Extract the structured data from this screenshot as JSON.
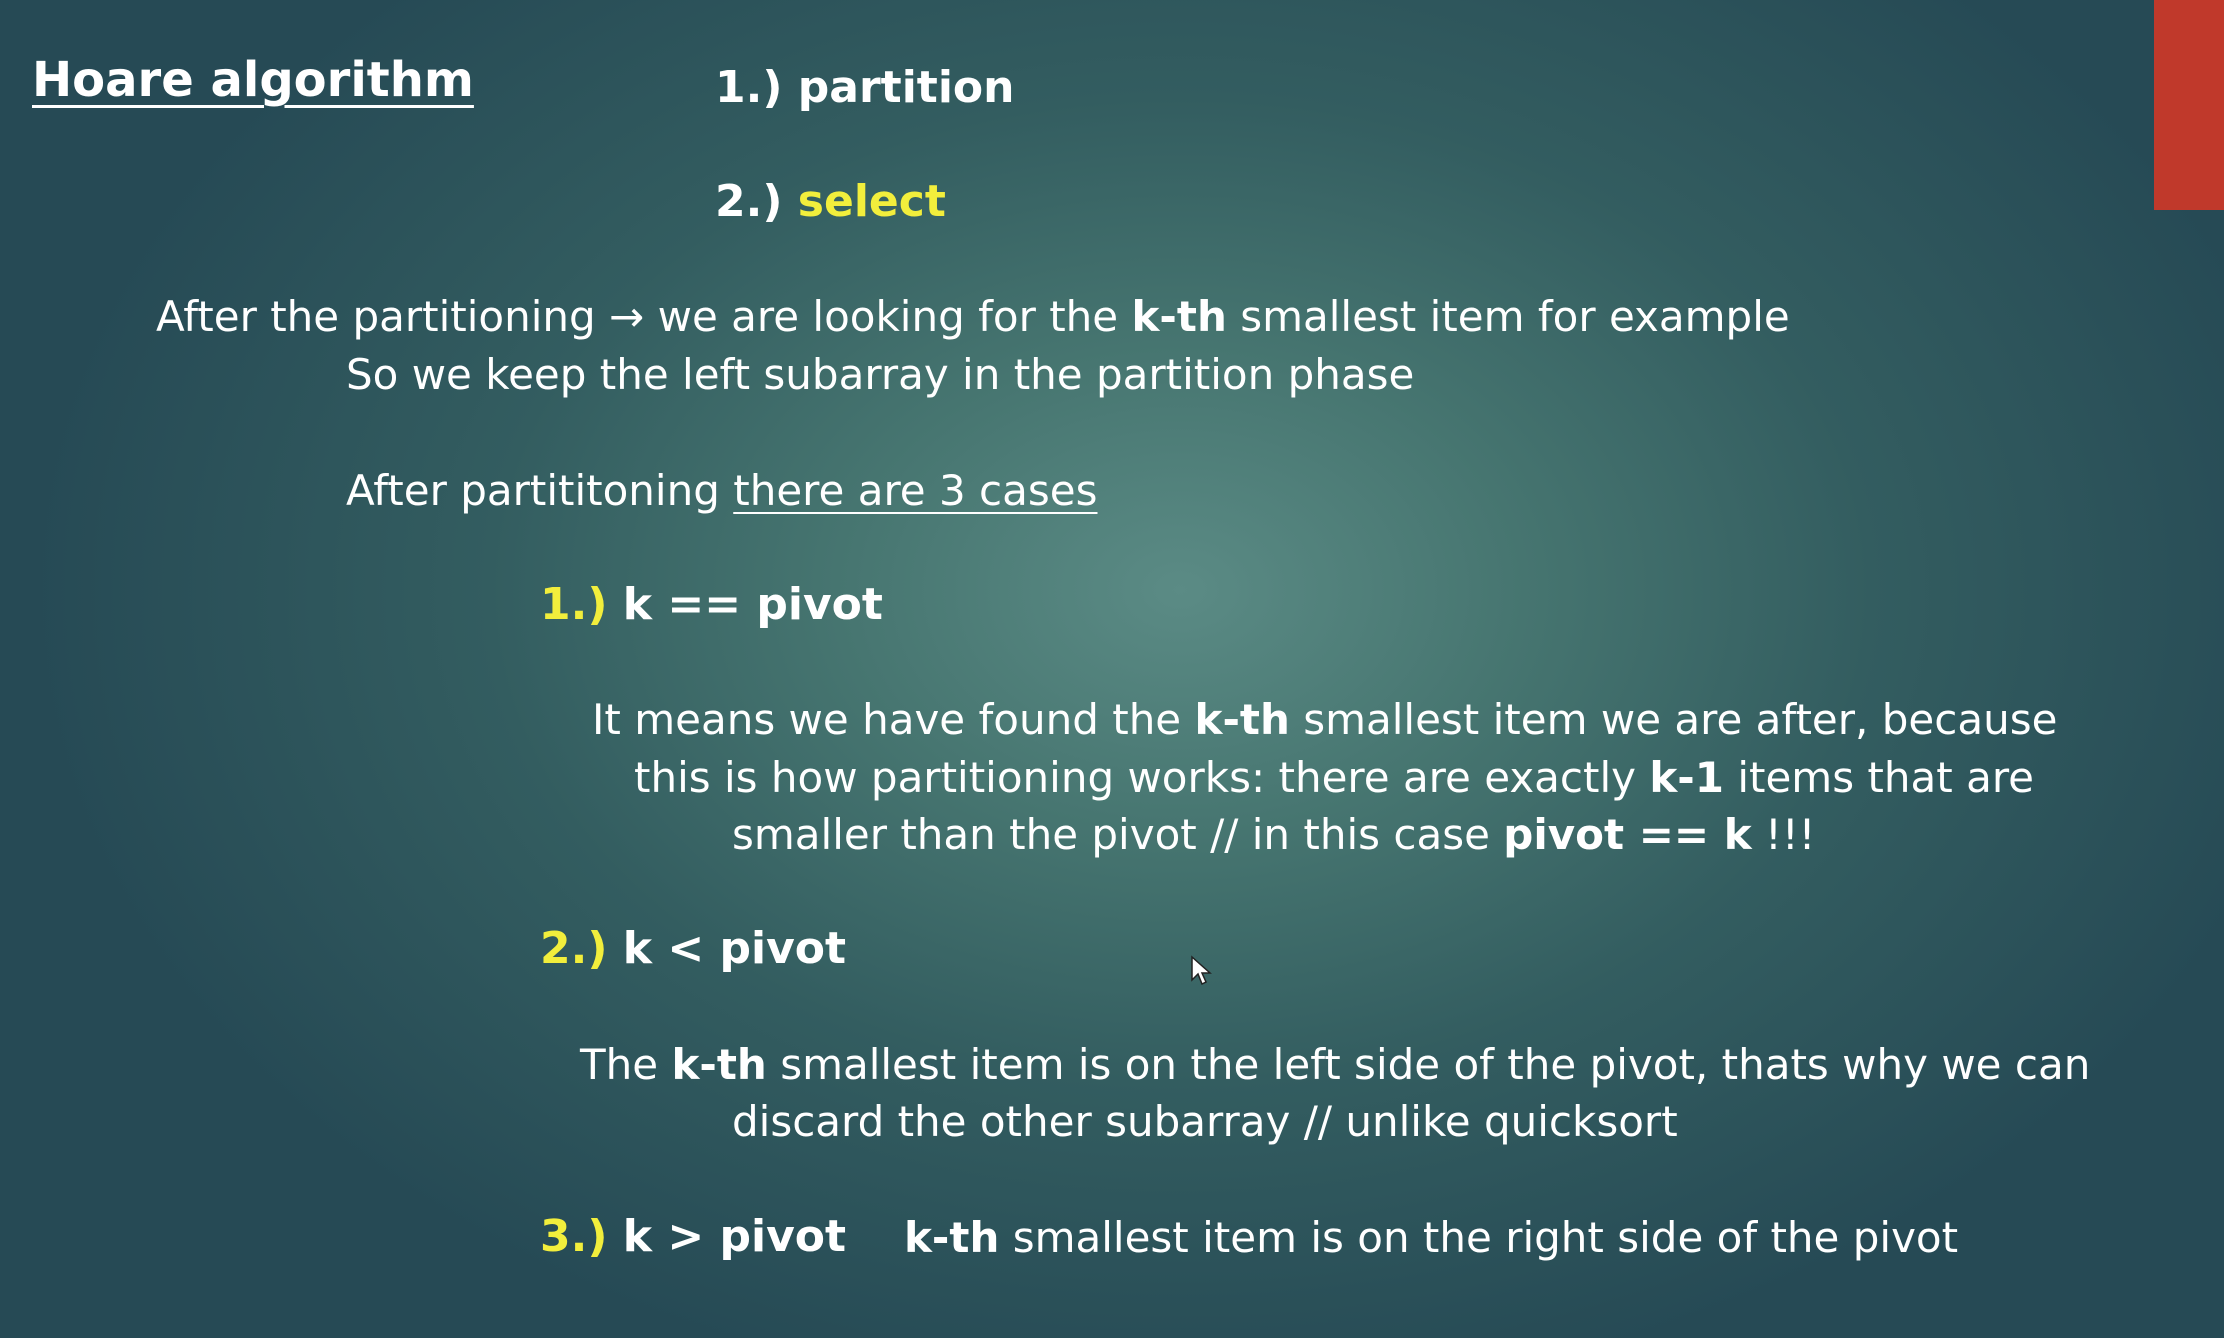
{
  "title": "Hoare algorithm",
  "steps": {
    "one_num": "1.)",
    "one_label": "partition",
    "two_num": "2.)",
    "two_label": "select"
  },
  "intro": {
    "line1_a": "After the partitioning",
    "arrow": "→",
    "line1_b": "we are looking for the",
    "kth": "k-th",
    "line1_c": "smallest item for example",
    "line2": "So we keep the left subarray in the partition phase"
  },
  "cases_intro": {
    "prefix": "After partititoning",
    "underlined": "there are 3 cases"
  },
  "case1": {
    "num": "1.)",
    "heading": "k == pivot",
    "l1_a": "It means we have found the",
    "l1_bold": "k-th",
    "l1_b": "smallest item we are after, because",
    "l2_a": "this is how partitioning works: there are exactly",
    "l2_bold": "k-1",
    "l2_b": "items that are",
    "l3_a": "smaller than the pivot // in this case",
    "l3_bold": "pivot == k",
    "l3_b": "!!!"
  },
  "case2": {
    "num": "2.)",
    "heading": "k < pivot",
    "l1_a": "The",
    "l1_bold": "k-th",
    "l1_b": "smallest item is on the left side of the pivot, thats why we can",
    "l2": "discard the other subarray // unlike quicksort"
  },
  "case3": {
    "num": "3.)",
    "heading": "k > pivot",
    "bold": "k-th",
    "text": "smallest item is on the right side of the pivot"
  },
  "colors": {
    "accent": "#c0392b",
    "highlight": "#f2ee3c",
    "text": "#ffffff"
  }
}
